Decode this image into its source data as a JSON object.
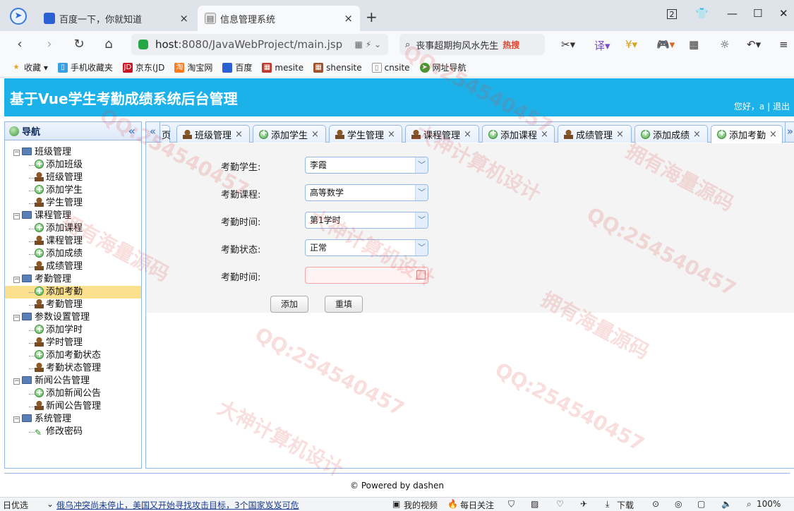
{
  "browser": {
    "tabs": [
      {
        "label": "百度一下，你就知道",
        "close": "×"
      },
      {
        "label": "信息管理系统",
        "close": "×"
      }
    ],
    "new_tab": "+",
    "tab_count": "2",
    "address": {
      "host": "host",
      "path": ":8080/JavaWebProject/main.jsp"
    },
    "search_text": "丧事超期拘风水先生",
    "search_badge": "热搜",
    "bookmarks": [
      "收藏",
      "手机收藏夹",
      "京东(JD",
      "淘宝网",
      "百度",
      "mesite",
      "shensite",
      "cnsite",
      "网址导航"
    ],
    "nav_icons": [
      "back-icon",
      "forward-icon",
      "reload-icon",
      "home-icon"
    ]
  },
  "app": {
    "title": "基于Vue学生考勤成绩系统后台管理",
    "greeting": "您好，a",
    "separator": "|",
    "logout": "退出",
    "nav_title": "导航",
    "collapse_glyph": "«",
    "tree": [
      {
        "label": "班级管理",
        "children": [
          {
            "label": "添加班级",
            "icon": "add"
          },
          {
            "label": "班级管理",
            "icon": "user"
          },
          {
            "label": "添加学生",
            "icon": "add"
          },
          {
            "label": "学生管理",
            "icon": "user"
          }
        ]
      },
      {
        "label": "课程管理",
        "children": [
          {
            "label": "添加课程",
            "icon": "add"
          },
          {
            "label": "课程管理",
            "icon": "user"
          },
          {
            "label": "添加成绩",
            "icon": "add"
          },
          {
            "label": "成绩管理",
            "icon": "user"
          }
        ]
      },
      {
        "label": "考勤管理",
        "children": [
          {
            "label": "添加考勤",
            "icon": "add",
            "selected": true
          },
          {
            "label": "考勤管理",
            "icon": "user"
          }
        ]
      },
      {
        "label": "参数设置管理",
        "children": [
          {
            "label": "添加学时",
            "icon": "add"
          },
          {
            "label": "学时管理",
            "icon": "user"
          },
          {
            "label": "添加考勤状态",
            "icon": "add"
          },
          {
            "label": "考勤状态管理",
            "icon": "user"
          }
        ]
      },
      {
        "label": "新闻公告管理",
        "children": [
          {
            "label": "添加新闻公告",
            "icon": "add"
          },
          {
            "label": "新闻公告管理",
            "icon": "user"
          }
        ]
      },
      {
        "label": "系统管理",
        "children": [
          {
            "label": "修改密码",
            "icon": "pen"
          }
        ]
      }
    ],
    "tabs": [
      {
        "label": "页",
        "icon": "none"
      },
      {
        "label": "班级管理",
        "icon": "user"
      },
      {
        "label": "添加学生",
        "icon": "add"
      },
      {
        "label": "学生管理",
        "icon": "user"
      },
      {
        "label": "课程管理",
        "icon": "user"
      },
      {
        "label": "添加课程",
        "icon": "add"
      },
      {
        "label": "成绩管理",
        "icon": "user"
      },
      {
        "label": "添加成绩",
        "icon": "add"
      },
      {
        "label": "添加考勤",
        "icon": "add",
        "active": true
      }
    ],
    "tab_close": "×",
    "form": {
      "student_label": "考勤学生:",
      "student_value": "李霞",
      "course_label": "考勤课程:",
      "course_value": "高等数学",
      "period_label": "考勤时间:",
      "period_value": "第1学时",
      "status_label": "考勤状态:",
      "status_value": "正常",
      "date_label": "考勤时间:",
      "date_value": "",
      "add_button": "添加",
      "reset_button": "重填"
    },
    "footer": "© Powered by dashen"
  },
  "statusbar": {
    "left": "日优选",
    "news": "俄乌冲突尚未停止，美国又开始寻找攻击目标，3个国家岌岌可危",
    "video": "我的视频",
    "daily": "每日关注",
    "download": "下载",
    "zoom": "100%"
  },
  "watermarks": [
    "QQ:254540457",
    "大神计算机设计",
    "拥有海量源码"
  ],
  "colors": {
    "header": "#1cb1e8",
    "border": "#95b8e7",
    "selected": "#fbe18d"
  }
}
